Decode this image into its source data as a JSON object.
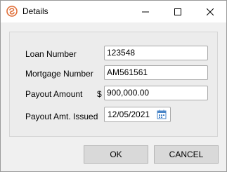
{
  "window": {
    "title": "Details",
    "icon": "app-swirl-icon",
    "accent": "#e0703a"
  },
  "titlebar_buttons": {
    "minimize": "minimize-icon",
    "maximize": "maximize-icon",
    "close": "close-icon"
  },
  "form": {
    "loan_number": {
      "label": "Loan Number",
      "value": "123548"
    },
    "mortgage_number": {
      "label": "Mortgage Number",
      "value": "AM561561"
    },
    "payout_amount": {
      "label": "Payout Amount",
      "currency": "$",
      "value": "900,000.00"
    },
    "payout_issued": {
      "label": "Payout Amt. Issued",
      "value": "12/05/2021",
      "icon": "calendar-icon"
    }
  },
  "buttons": {
    "ok": "OK",
    "cancel": "CANCEL"
  }
}
